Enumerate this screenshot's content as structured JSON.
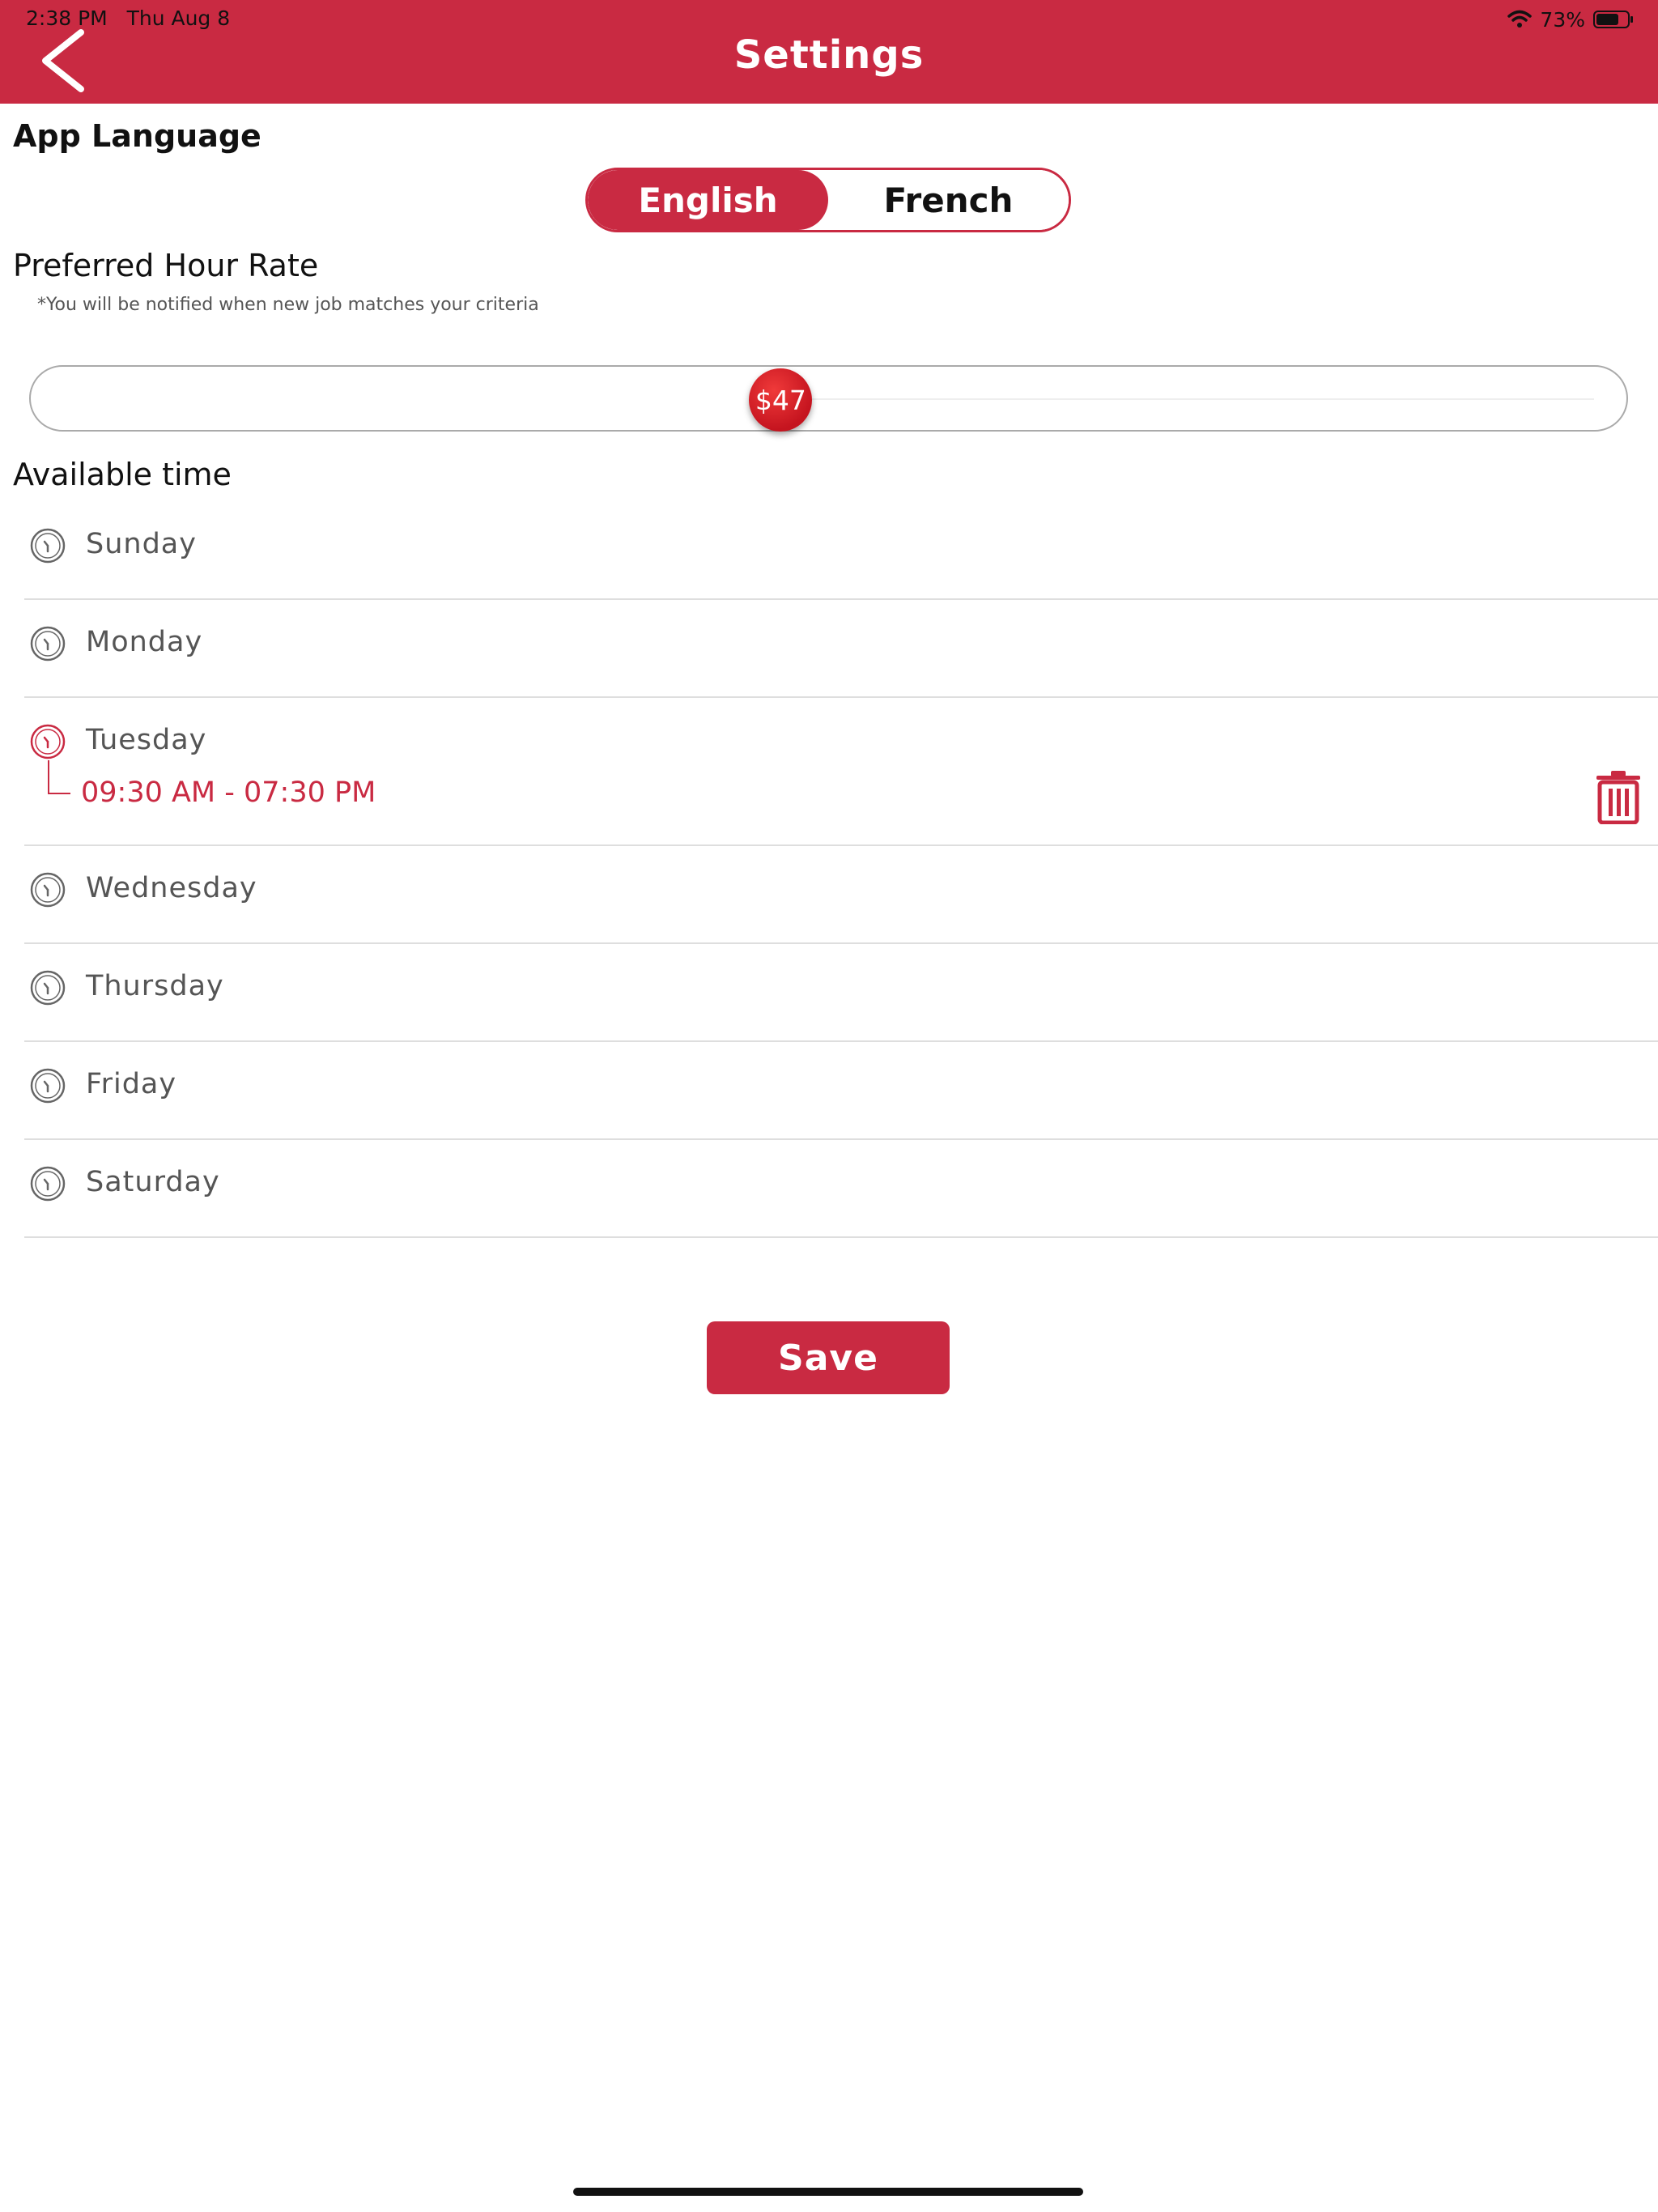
{
  "status_bar": {
    "time": "2:38 PM",
    "date": "Thu Aug 8",
    "battery": "73%",
    "battery_level": 0.73
  },
  "header": {
    "title": "Settings",
    "back_icon": "chevron-left-icon"
  },
  "app_language": {
    "label": "App Language",
    "options": [
      "English",
      "French"
    ],
    "selected": "English"
  },
  "hour_rate": {
    "label": "Preferred Hour Rate",
    "note": "*You will be notified when new job matches your criteria",
    "value_label": "$47",
    "slider_fraction": 0.47
  },
  "available_time": {
    "label": "Available time",
    "days": [
      {
        "name": "Sunday"
      },
      {
        "name": "Monday"
      },
      {
        "name": "Tuesday",
        "time_range": "09:30 AM - 07:30 PM"
      },
      {
        "name": "Wednesday"
      },
      {
        "name": "Thursday"
      },
      {
        "name": "Friday"
      },
      {
        "name": "Saturday"
      }
    ]
  },
  "actions": {
    "save_label": "Save"
  },
  "colors": {
    "accent": "#c92a42",
    "icon_gray": "#666666",
    "divider": "#dedede"
  }
}
